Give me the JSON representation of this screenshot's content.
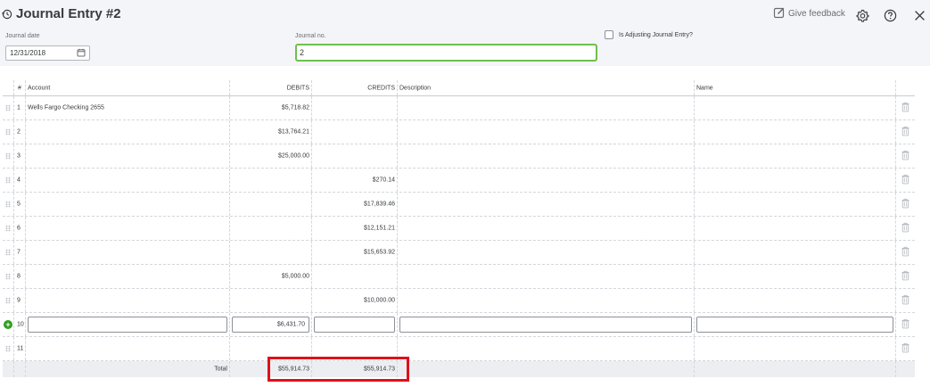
{
  "header": {
    "title": "Journal Entry #2",
    "feedback_label": "Give feedback"
  },
  "form": {
    "journal_date_label": "Journal date",
    "journal_date_value": "12/31/2018",
    "journal_no_label": "Journal no.",
    "journal_no_value": "2",
    "adjusting_label": "Is Adjusting Journal Entry?",
    "adjusting_checked": false
  },
  "table": {
    "columns": {
      "num": "#",
      "account": "Account",
      "debits": "DEBITS",
      "credits": "CREDITS",
      "description": "Description",
      "name": "Name"
    },
    "rows": [
      {
        "num": "1",
        "account": "Wells Fargo Checking 2655",
        "debit": "$5,718.82",
        "credit": "",
        "description": "",
        "name": ""
      },
      {
        "num": "2",
        "account": "",
        "debit": "$13,764.21",
        "credit": "",
        "description": "",
        "name": ""
      },
      {
        "num": "3",
        "account": "",
        "debit": "$25,000.00",
        "credit": "",
        "description": "",
        "name": ""
      },
      {
        "num": "4",
        "account": "",
        "debit": "",
        "credit": "$270.14",
        "description": "",
        "name": ""
      },
      {
        "num": "5",
        "account": "",
        "debit": "",
        "credit": "$17,839.46",
        "description": "",
        "name": ""
      },
      {
        "num": "6",
        "account": "",
        "debit": "",
        "credit": "$12,151.21",
        "description": "",
        "name": ""
      },
      {
        "num": "7",
        "account": "",
        "debit": "",
        "credit": "$15,653.92",
        "description": "",
        "name": ""
      },
      {
        "num": "8",
        "account": "",
        "debit": "$5,000.00",
        "credit": "",
        "description": "",
        "name": ""
      },
      {
        "num": "9",
        "account": "",
        "debit": "",
        "credit": "$10,000.00",
        "description": "",
        "name": ""
      },
      {
        "num": "10",
        "account": "",
        "debit": "$6,431.70",
        "credit": "",
        "description": "",
        "name": "",
        "editing": true
      },
      {
        "num": "11",
        "account": "",
        "debit": "",
        "credit": "",
        "description": "",
        "name": ""
      }
    ],
    "total_label": "Total",
    "total_debits": "$55,914.73",
    "total_credits": "$55,914.73"
  },
  "icons": {
    "history": "history-clock-icon",
    "feedback": "feedback-pencil-icon",
    "settings": "gear-icon",
    "help": "help-icon",
    "close": "close-icon",
    "calendar": "calendar-icon",
    "drag": "drag-handle-icon",
    "delete": "trash-icon",
    "add": "add-line-icon"
  },
  "colors": {
    "header_bg": "#f4f5f8",
    "focus_green": "#6fbf4d",
    "add_green": "#2ca01c",
    "highlight_red": "#e0101a"
  }
}
